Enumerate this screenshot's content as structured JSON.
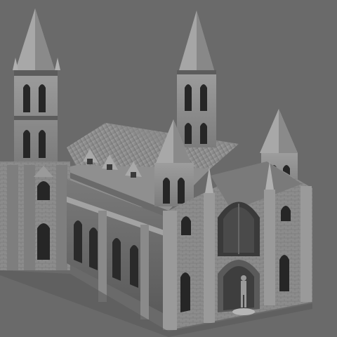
{
  "viewport": {
    "background": "#6a6a6a"
  },
  "scene": {
    "subject_icon": "gothic-cathedral-model",
    "palette": {
      "stone_light": "#b4b4b4",
      "stone_mid": "#8e8e8e",
      "stone_dark": "#5c5c5c",
      "shadow": "#3a3a3a",
      "window": "#262626",
      "roof": "#9a9a9a",
      "roof_dark": "#6e6e6e"
    }
  }
}
